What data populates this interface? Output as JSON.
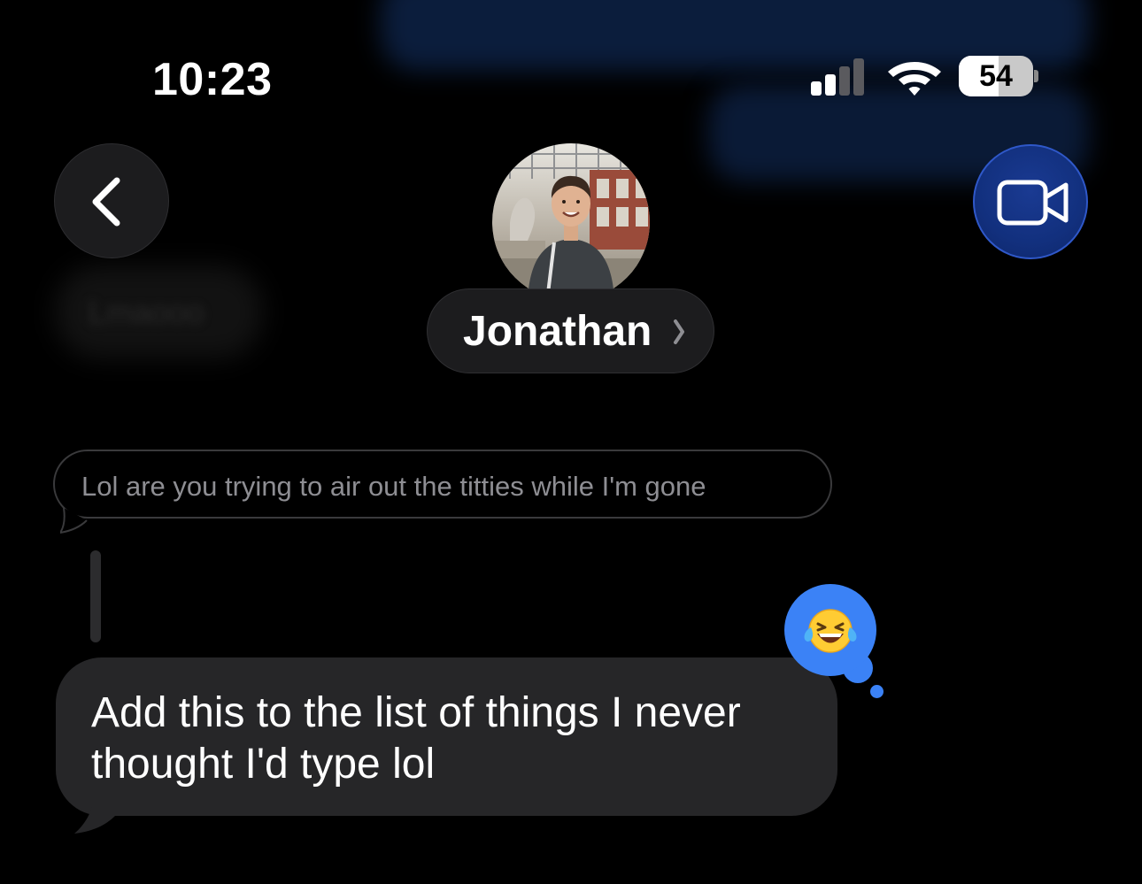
{
  "status_bar": {
    "time": "10:23",
    "signal_icon": "cellular-signal-icon",
    "signal_bars_active": 2,
    "signal_bars_total": 4,
    "wifi_icon": "wifi-icon",
    "battery_percent": "54",
    "battery_level": 0.54
  },
  "nav": {
    "back_icon": "chevron-left-icon",
    "video_icon": "video-camera-icon",
    "video_accent": "#12307e"
  },
  "contact": {
    "name": "Jonathan",
    "avatar_icon": "contact-photo",
    "chevron_icon": "chevron-right-icon"
  },
  "conversation": {
    "reply_preview": "Lol are you trying to air out the titties while I'm gone",
    "message": "Add this to the list of things I never thought I'd type lol",
    "reaction": {
      "emoji": "😂",
      "icon": "laughing-with-tears-emoji",
      "color": "#3b82f6"
    }
  },
  "background_blurred": {
    "left_bubble_text": "Lmaooo"
  }
}
